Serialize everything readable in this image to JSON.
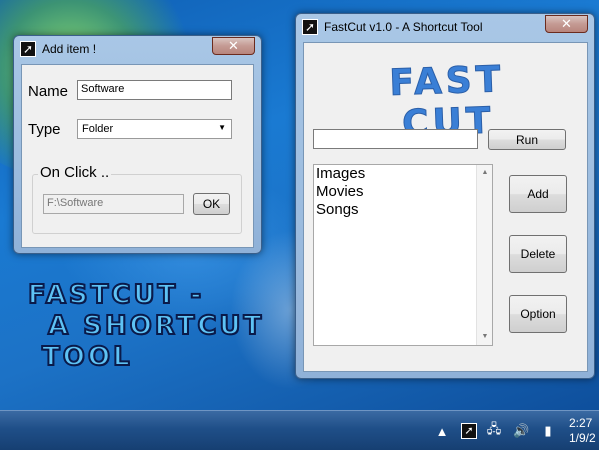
{
  "desktop": {
    "art_text": [
      "Fastcut -",
      "A Shortcut",
      "tool"
    ]
  },
  "add_item_dialog": {
    "title": "Add item !",
    "close_label": "✕",
    "name_label": "Name",
    "name_value": "Software",
    "type_label": "Type",
    "type_value": "Folder",
    "group_title": "On Click ..",
    "path_value": "F:\\Software",
    "ok_label": "OK"
  },
  "main_window": {
    "title": "FastCut v1.0 - A Shortcut Tool",
    "close_label": "✕",
    "logo_text": "Fast Cut",
    "command_value": "",
    "run_label": "Run",
    "list_items": [
      "Images",
      "Movies",
      "Songs"
    ],
    "add_label": "Add",
    "delete_label": "Delete",
    "option_label": "Option"
  },
  "taskbar": {
    "clock_time": "2:27",
    "clock_date": "1/9/2"
  },
  "icons": {
    "app": "arrow-shortcut-icon",
    "tray": [
      "show-hidden-icon",
      "fastcut-tray-icon",
      "network-icon",
      "volume-icon",
      "battery-icon"
    ]
  }
}
